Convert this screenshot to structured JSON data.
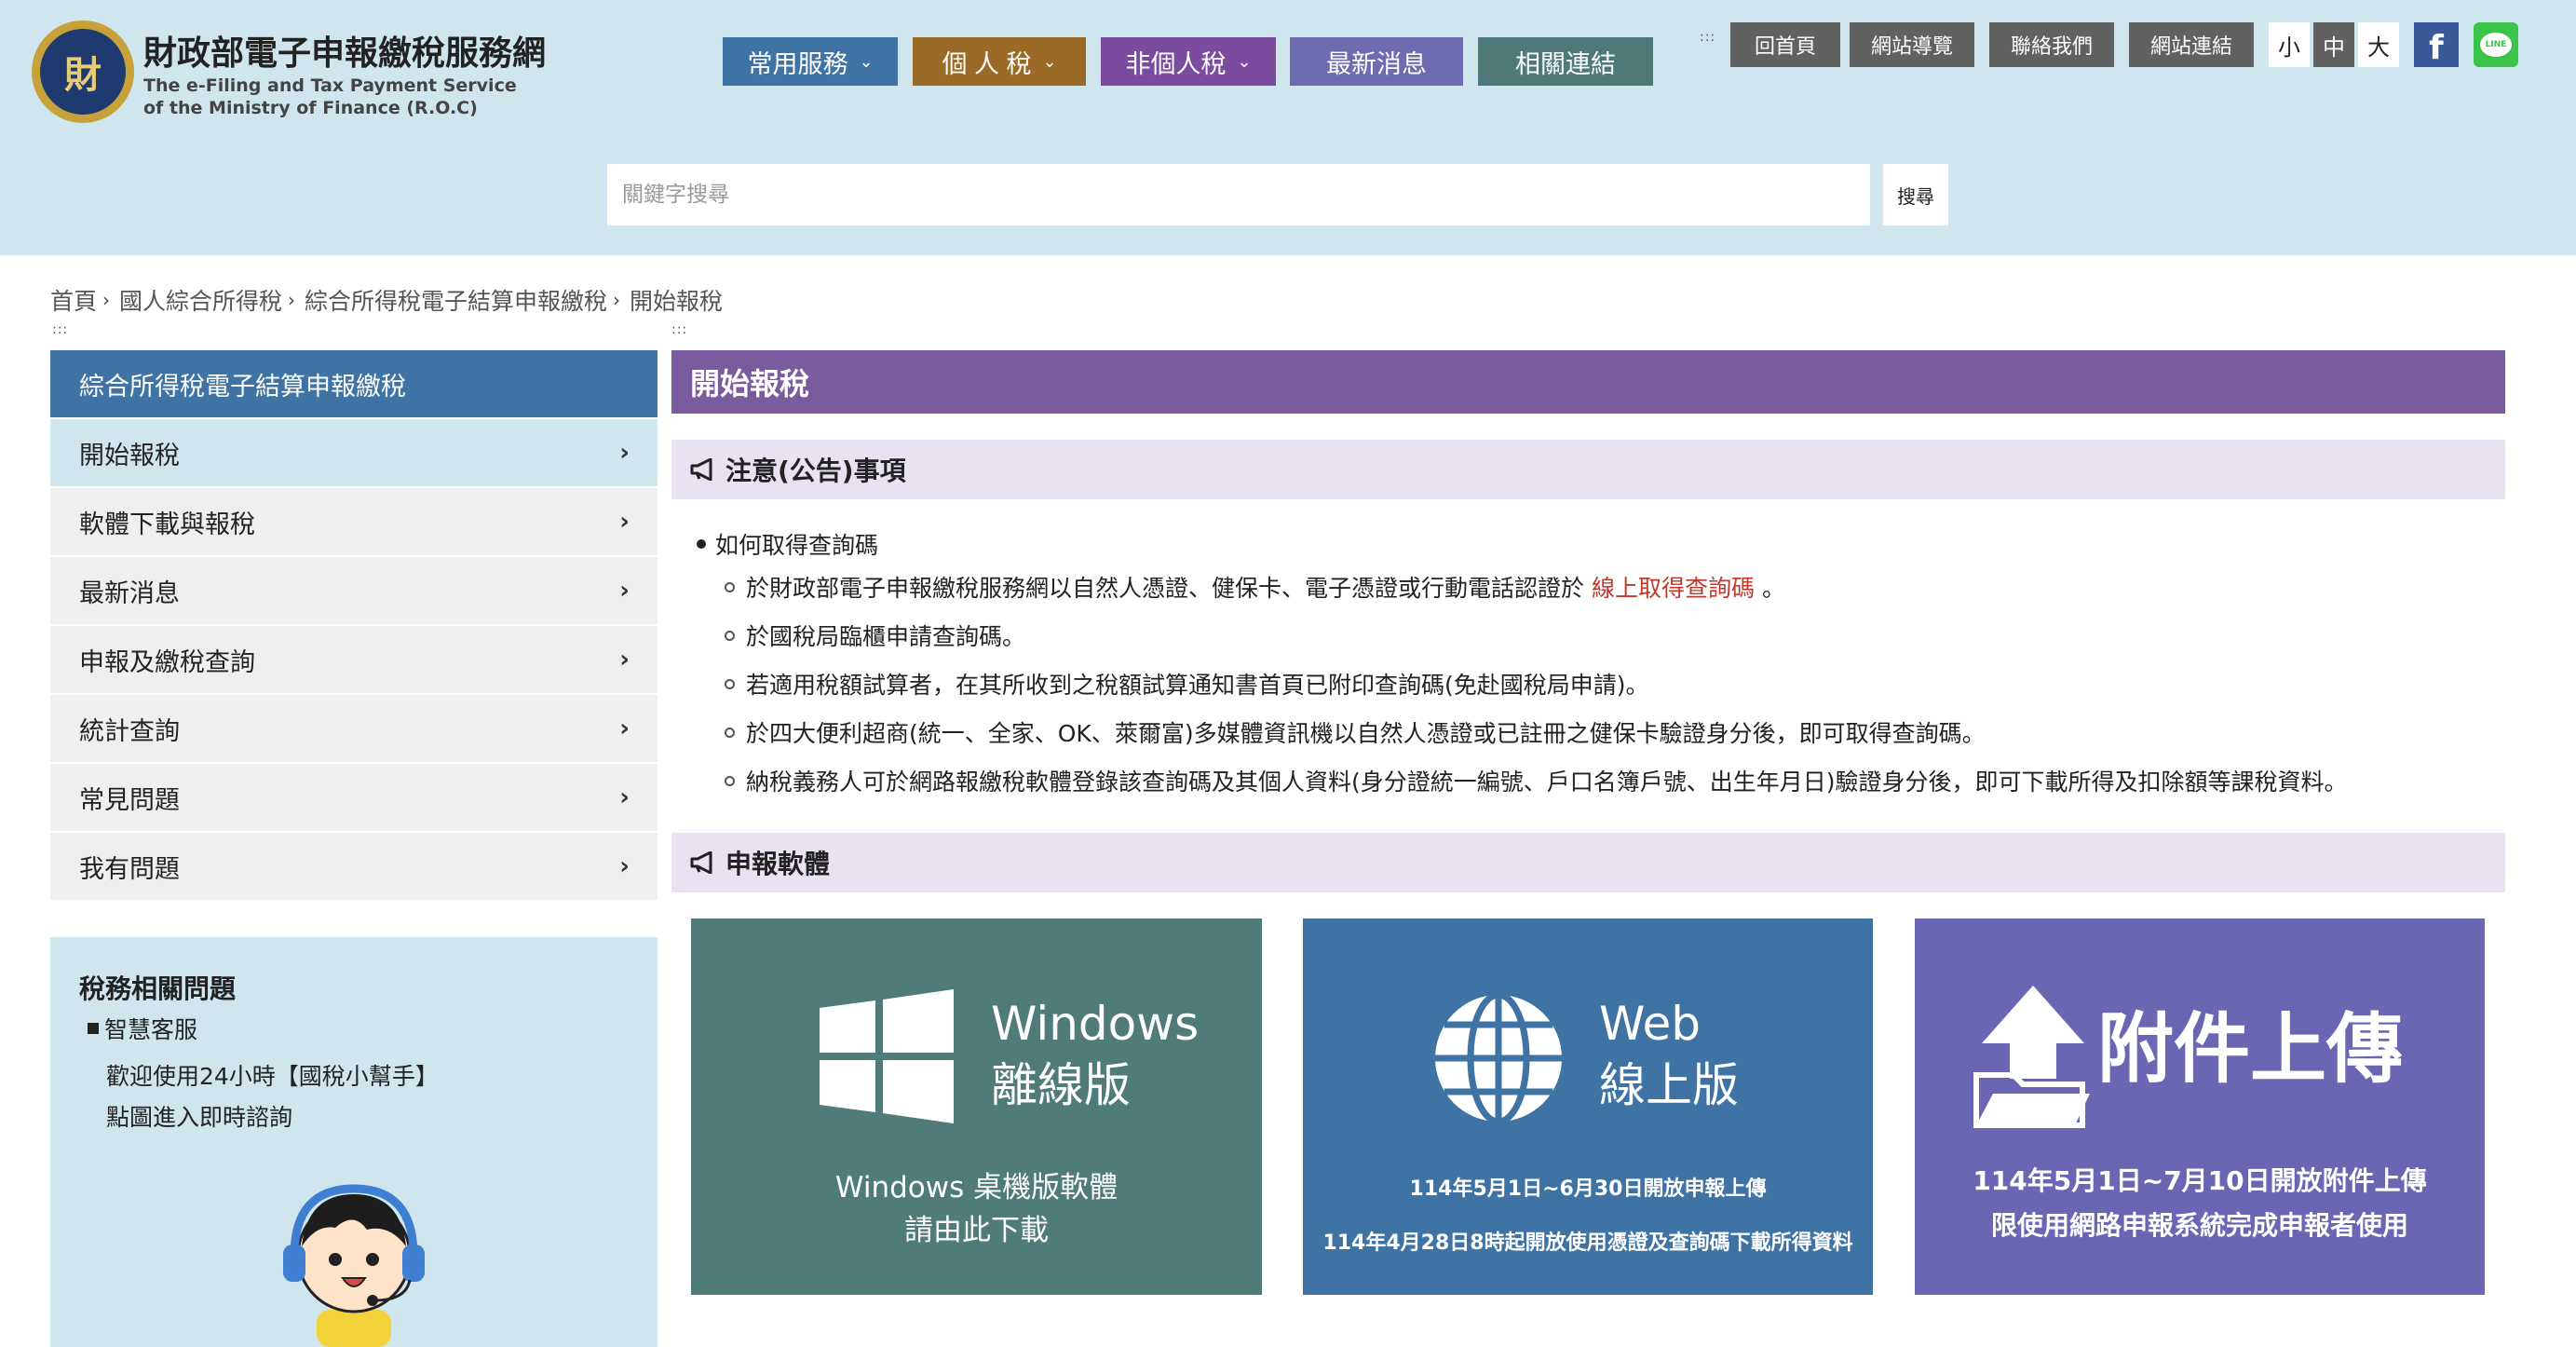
{
  "header": {
    "logo_text": "財",
    "site_title": "財政部電子申報繳稅服務網",
    "site_subtitle": "The e-Filing and Tax Payment Service of the Ministry of Finance (R.O.C)"
  },
  "main_nav": [
    {
      "label": "常用服務",
      "has_dropdown": true
    },
    {
      "label": "個 人 稅",
      "has_dropdown": true
    },
    {
      "label": "非個人稅",
      "has_dropdown": true
    },
    {
      "label": "最新消息",
      "has_dropdown": false
    },
    {
      "label": "相關連結",
      "has_dropdown": false
    }
  ],
  "utility_nav": {
    "grip": ":::",
    "home": "回首頁",
    "site_guide": "網站導覽",
    "contact": "聯絡我們",
    "site_links": "網站連結"
  },
  "font_size": {
    "small": "小",
    "medium": "中",
    "large": "大",
    "selected": "中"
  },
  "social": {
    "facebook": "f",
    "line": "LINE"
  },
  "search": {
    "placeholder": "關鍵字搜尋",
    "button": "搜尋"
  },
  "breadcrumb": [
    "首頁",
    "國人綜合所得稅",
    "綜合所得稅電子結算申報繳稅",
    "開始報稅"
  ],
  "grip": ":::",
  "sidebar": {
    "heading": "綜合所得稅電子結算申報繳稅",
    "items": [
      {
        "label": "開始報稅",
        "active": true
      },
      {
        "label": "軟體下載與報稅",
        "active": false
      },
      {
        "label": "最新消息",
        "active": false
      },
      {
        "label": "申報及繳稅查詢",
        "active": false
      },
      {
        "label": "統計查詢",
        "active": false
      },
      {
        "label": "常見問題",
        "active": false
      },
      {
        "label": "我有問題",
        "active": false
      }
    ]
  },
  "tax_help": {
    "title": "稅務相關問題",
    "bullet": "智慧客服",
    "line1": "歡迎使用24小時【國稅小幫手】",
    "line2": "點圖進入即時諮詢"
  },
  "main": {
    "title": "開始報稅",
    "notice_heading": "注意(公告)事項",
    "notice_list": {
      "item": "如何取得查詢碼",
      "sub1_prefix": "於財政部電子申報繳稅服務網以自然人憑證、健保卡、電子憑證或行動電話認證於",
      "sub1_link": "線上取得查詢碼",
      "sub1_suffix": "。",
      "sub2": "於國稅局臨櫃申請查詢碼。",
      "sub3": "若適用稅額試算者，在其所收到之稅額試算通知書首頁已附印查詢碼(免赴國稅局申請)。",
      "sub4": "於四大便利超商(統一、全家、OK、萊爾富)多媒體資訊機以自然人憑證或已註冊之健保卡驗證身分後，即可取得查詢碼。",
      "sub5": "納稅義務人可於網路報繳稅軟體登錄該查詢碼及其個人資料(身分證統一編號、戶口名簿戶號、出生年月日)驗證身分後，即可下載所得及扣除額等課稅資料。"
    },
    "software_heading": "申報軟體",
    "cards": {
      "windows": {
        "title1": "Windows",
        "title2": "離線版",
        "desc1": "Windows 桌機版軟體",
        "desc2": "請由此下載"
      },
      "web": {
        "title1": "Web",
        "title2": "線上版",
        "note1": "114年5月1日~6月30日開放申報上傳",
        "note2": "114年4月28日8時起開放使用憑證及查詢碼下載所得資料"
      },
      "upload": {
        "title": "附件上傳",
        "note1": "114年5月1日~7月10日開放附件上傳",
        "note2": "限使用網路申報系統完成申報者使用"
      }
    }
  },
  "colors": {
    "header_bg": "#cfe6ee",
    "nav_blue": "#3e73a4",
    "nav_brown": "#9c6a27",
    "nav_purple": "#7a4b9e",
    "nav_violet": "#6f6bb0",
    "nav_teal": "#4d7a79",
    "title_purple": "#7a5c9e",
    "section_lavender": "#e9e2f3",
    "link_red": "#c0392b"
  }
}
